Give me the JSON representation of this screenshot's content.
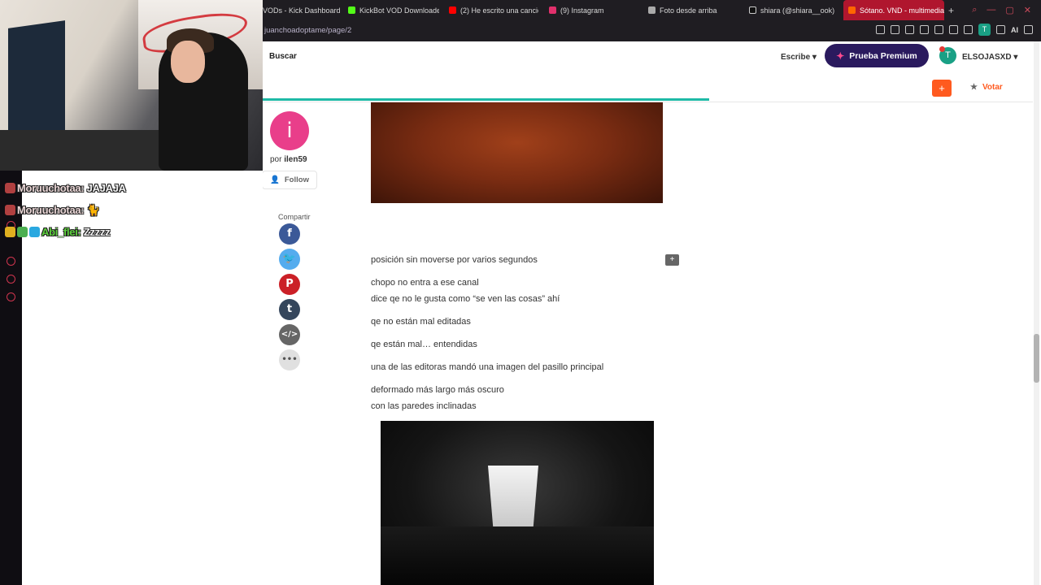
{
  "browser": {
    "tabs": [
      {
        "label": "VODs - Kick Dashboard",
        "color": "#1f1d22"
      },
      {
        "label": "KickBot VOD Downloade",
        "color": "#53fc18"
      },
      {
        "label": "(2) He escrito una canció",
        "color": "#ff0000"
      },
      {
        "label": "(9) Instagram",
        "color": "#e1306c"
      },
      {
        "label": "Foto desde arriba",
        "color": "#aaaaaa"
      },
      {
        "label": "shiara (@shiara__ook) |",
        "color": "#111111"
      },
      {
        "label": "Sótano. VND - multimedia",
        "color": "#ff6600"
      }
    ],
    "active_tab_index": 6,
    "url": "juanchoadoptame/page/2"
  },
  "site": {
    "search_label": "Buscar",
    "write_label": "Escribe",
    "premium_label": "Prueba Premium",
    "user_initial": "T",
    "username": "ELSOJASXD",
    "plus_label": "+",
    "vote_label": "Votar",
    "accent_color": "#ff5a1f",
    "progress_fraction": 0.58
  },
  "author": {
    "initial": "i",
    "by_prefix": "por",
    "name": "ilen59",
    "follow_label": "Follow"
  },
  "share": {
    "label": "Compartir",
    "buttons": [
      {
        "icon": "facebook-icon",
        "glyph": "f",
        "color": "#3b5998"
      },
      {
        "icon": "twitter-icon",
        "glyph": "t",
        "color": "#55acee"
      },
      {
        "icon": "pinterest-icon",
        "glyph": "P",
        "color": "#cb2027"
      },
      {
        "icon": "tumblr-icon",
        "glyph": "t",
        "color": "#35465c"
      },
      {
        "icon": "embed-icon",
        "glyph": "</>",
        "color": "#666666"
      },
      {
        "icon": "more-icon",
        "glyph": "•••",
        "color": "#e0e0e0"
      }
    ]
  },
  "story": {
    "paragraphs": [
      "posición sin moverse por varios segundos",
      "chopo no entra a ese canal",
      "dice qe no le gusta como “se ven las cosas” ahí",
      "qe no están mal editadas",
      "qe están mal… entendidas",
      "una de las editoras mandó una imagen del pasillo principal",
      "deformado más largo más oscuro",
      "con las paredes inclinadas"
    ]
  },
  "chat": {
    "messages": [
      {
        "user": "Moruuchotaa:",
        "text": "JAJAJA"
      },
      {
        "user": "Moruuchotaa:",
        "text": "🐈"
      },
      {
        "user": "Abi_flei:",
        "text": "Zzzzz"
      }
    ]
  }
}
